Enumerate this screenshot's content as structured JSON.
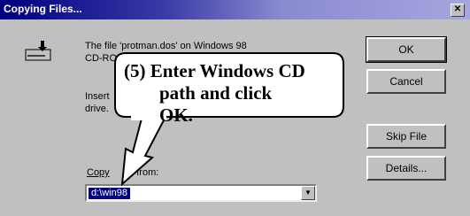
{
  "window": {
    "title": "Copying Files..."
  },
  "message": {
    "line1": "The file 'protman.dos' on Windows 98",
    "line2": "CD-RO",
    "line3": "Insert",
    "line4": "drive."
  },
  "buttons": {
    "ok": "OK",
    "cancel": "Cancel",
    "skip": "Skip File",
    "details": "Details..."
  },
  "copy_from": {
    "label_start": "Copy",
    "label_end": "s from:",
    "value": "d:\\win98"
  },
  "callout": {
    "line1": "(5) Enter Windows CD",
    "line2": "path and click OK."
  }
}
